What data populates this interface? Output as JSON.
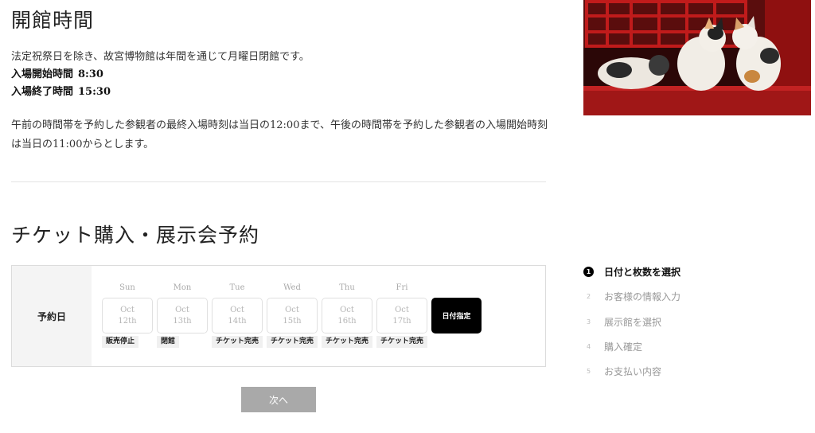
{
  "hours": {
    "title": "開館時間",
    "closed_note": "法定祝祭日を除き、故宮博物館は年間を通じて月曜日閉館です。",
    "open_label": "入場開始時間",
    "open_time": "8:30",
    "close_label": "入場終了時間",
    "close_time": "15:30",
    "entry_note": "午前の時間帯を予約した参観者の最終入場時刻は当日の12:00まで、午後の時間帯を予約した参観者の入場開始時刻は当日の11:00からとします。"
  },
  "ticket": {
    "title": "チケット購入・展示会予約",
    "date_label": "予約日",
    "days": [
      {
        "weekday": "Sun",
        "month": "Oct",
        "day": "12th",
        "status": "販売停止"
      },
      {
        "weekday": "Mon",
        "month": "Oct",
        "day": "13th",
        "status": "閉館"
      },
      {
        "weekday": "Tue",
        "month": "Oct",
        "day": "14th",
        "status": "チケット完売"
      },
      {
        "weekday": "Wed",
        "month": "Oct",
        "day": "15th",
        "status": "チケット完売"
      },
      {
        "weekday": "Thu",
        "month": "Oct",
        "day": "16th",
        "status": "チケット完売"
      },
      {
        "weekday": "Fri",
        "month": "Oct",
        "day": "17th",
        "status": "チケット完売"
      }
    ],
    "date_picker_label": "日付指定",
    "next_label": "次へ"
  },
  "steps": [
    {
      "num": "1",
      "label": "日付と枚数を選択",
      "active": true
    },
    {
      "num": "2",
      "label": "お客様の情報入力",
      "active": false
    },
    {
      "num": "3",
      "label": "展示館を選択",
      "active": false
    },
    {
      "num": "4",
      "label": "購入確定",
      "active": false
    },
    {
      "num": "5",
      "label": "お支払い内容",
      "active": false
    }
  ],
  "colors": {
    "active_step": "#000000",
    "next_button": "#a9a9a9",
    "date_picker": "#000000"
  }
}
